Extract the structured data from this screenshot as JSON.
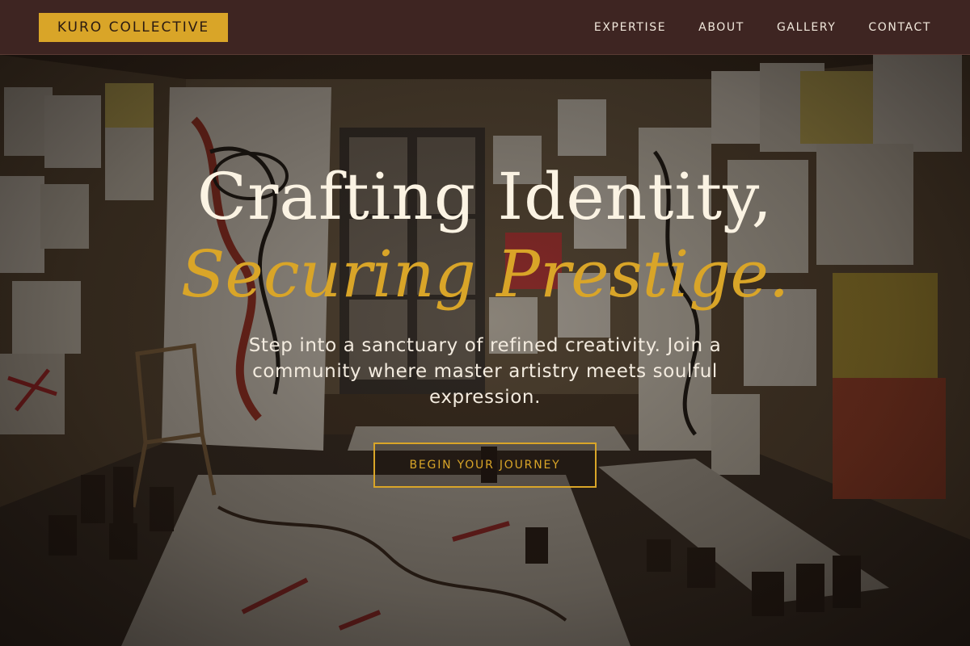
{
  "header": {
    "logo_text": "KURO COLLECTIVE",
    "nav": [
      {
        "label": "EXPERTISE"
      },
      {
        "label": "ABOUT"
      },
      {
        "label": "GALLERY"
      },
      {
        "label": "CONTACT"
      }
    ]
  },
  "hero": {
    "headline_line1": "Crafting Identity,",
    "headline_line2": "Securing Prestige.",
    "subtitle": "Step into a sanctuary of refined creativity. Join a community where master artistry meets soulful expression.",
    "cta_label": "BEGIN YOUR JOURNEY",
    "background_image": "art-studio-room-with-paintings"
  },
  "colors": {
    "accent": "#d9a528",
    "header_bg": "#3e2522",
    "headline_text": "#fbf3e3"
  }
}
